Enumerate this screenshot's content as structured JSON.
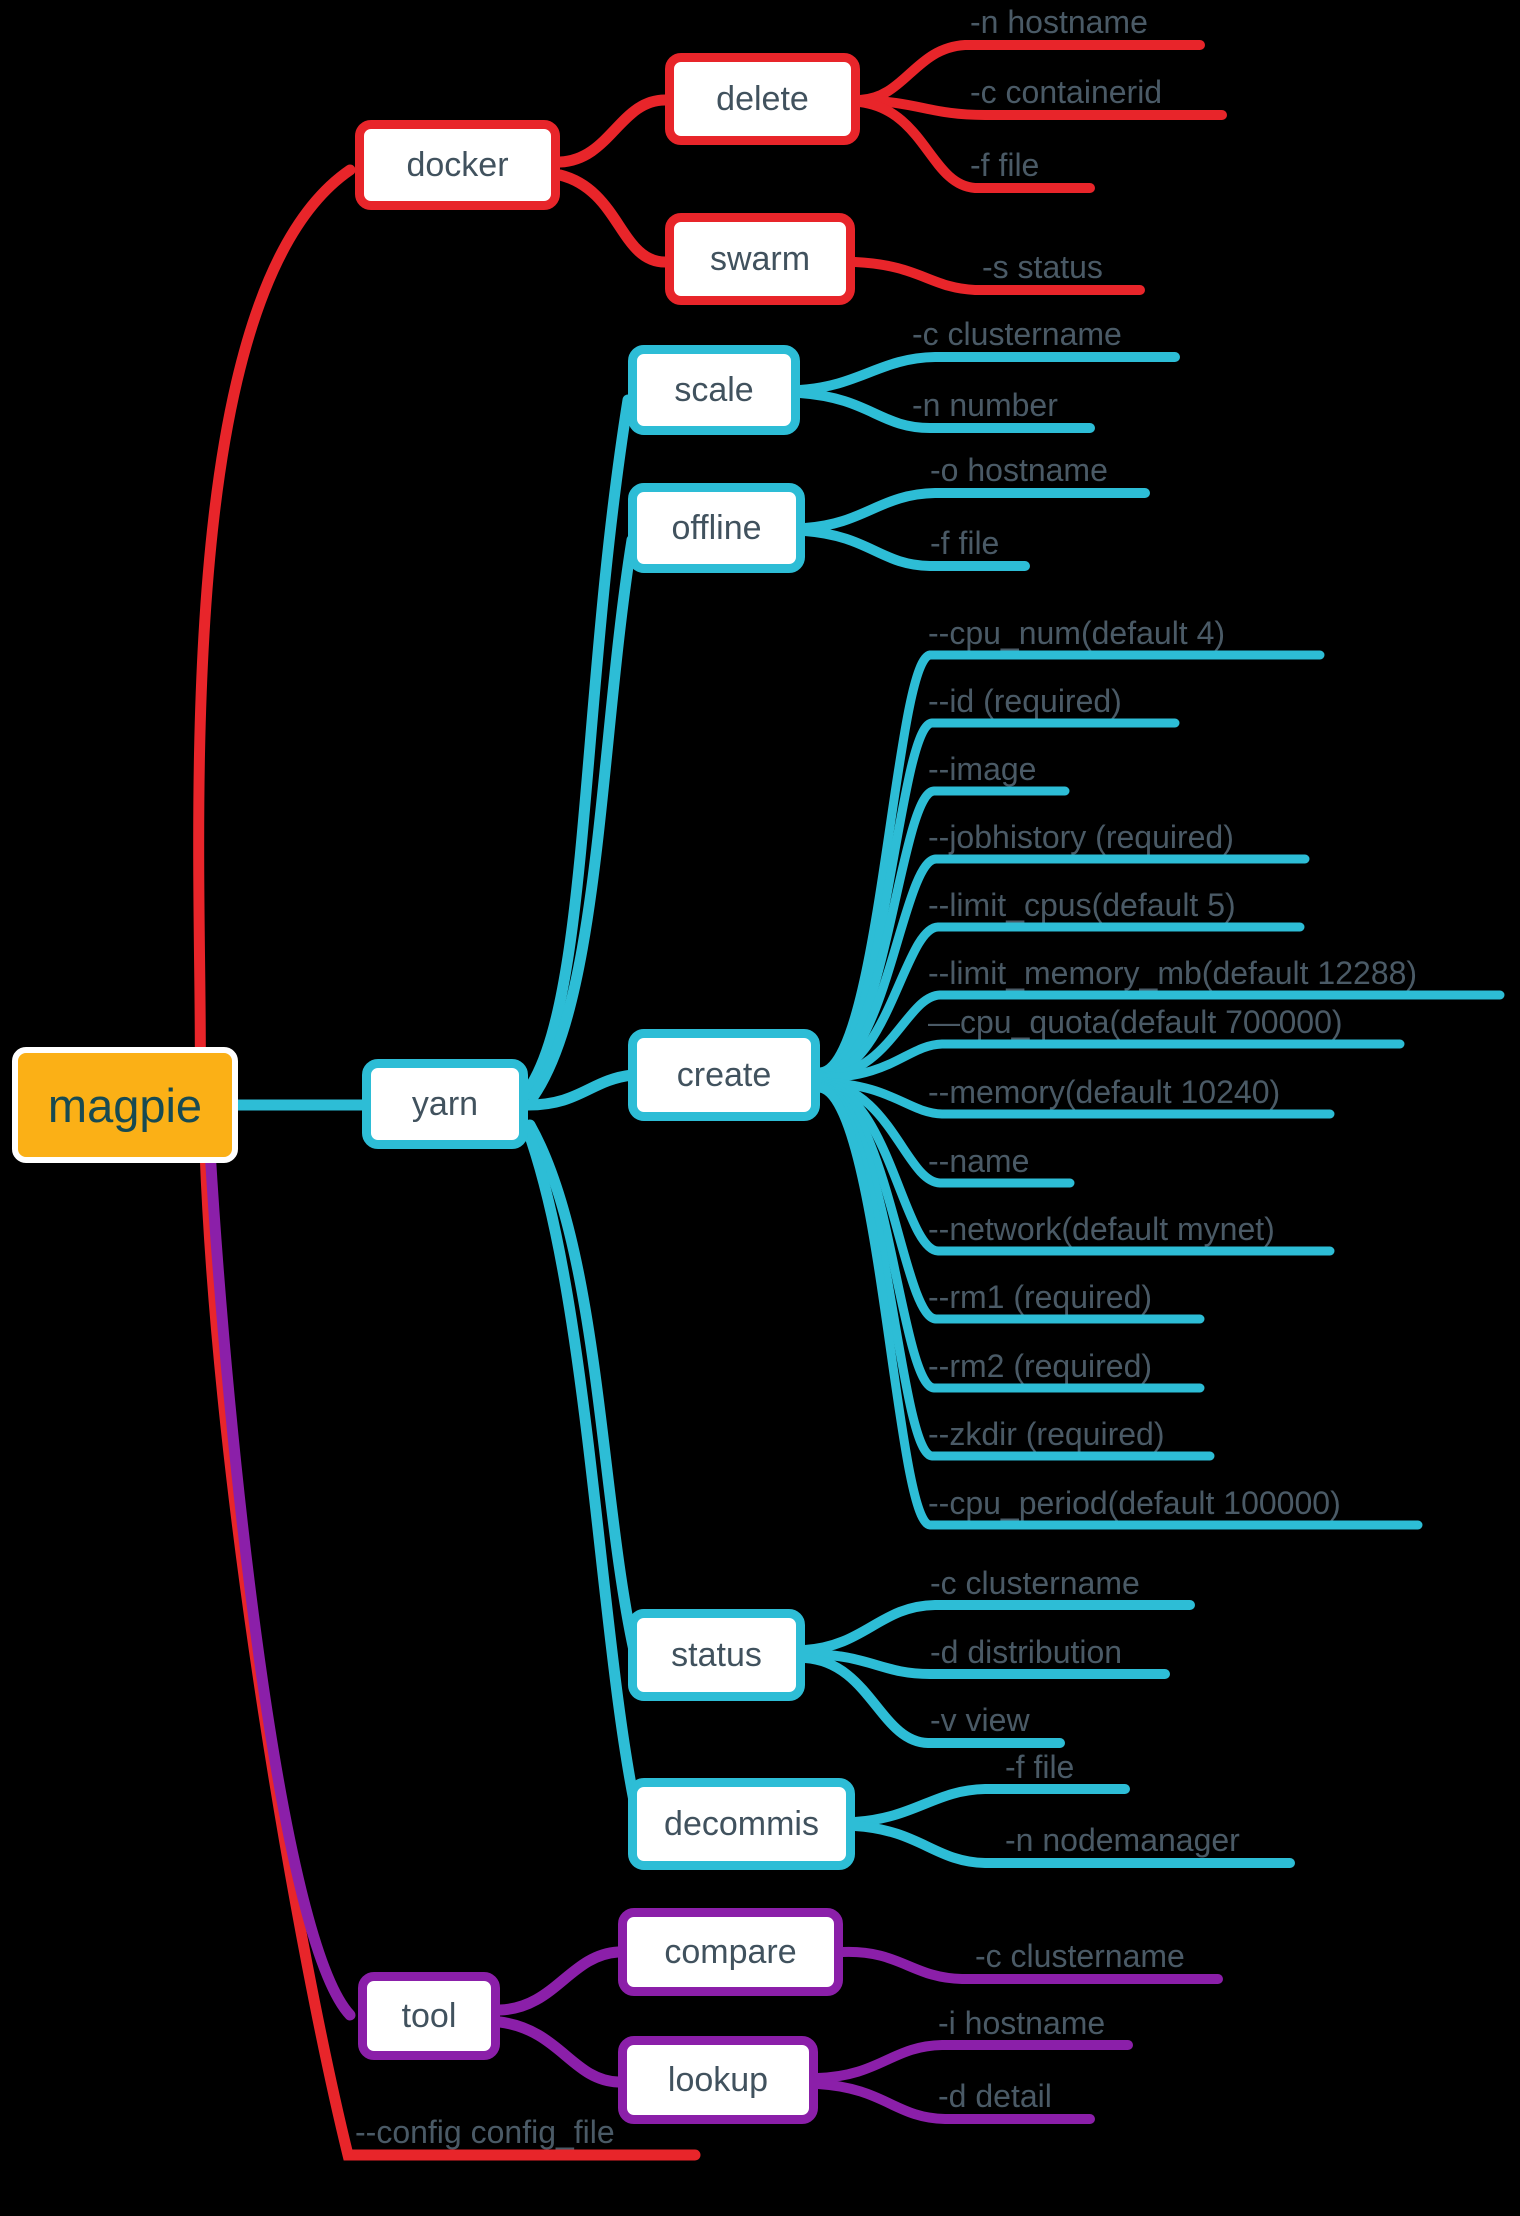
{
  "diagram": {
    "title": "magpie command mind map",
    "background": "#000000",
    "text_color": "#4A5A66",
    "root": {
      "label": "magpie",
      "fill": "#FBB016",
      "border": "#FFFFFF",
      "text": "#174A52"
    },
    "branch_colors": {
      "docker": "#E8252A",
      "yarn": "#2DBDD6",
      "tool": "#8B1FA9"
    },
    "branches": [
      {
        "id": "docker",
        "label": "docker",
        "color": "#E8252A",
        "children": [
          {
            "id": "delete",
            "label": "delete",
            "options": [
              "-n hostname",
              "-c containerid",
              "-f file"
            ]
          },
          {
            "id": "swarm",
            "label": "swarm",
            "options": [
              "-s status"
            ]
          }
        ]
      },
      {
        "id": "yarn",
        "label": "yarn",
        "color": "#2DBDD6",
        "children": [
          {
            "id": "scale",
            "label": "scale",
            "options": [
              "-c clustername",
              "-n number"
            ]
          },
          {
            "id": "offline",
            "label": "offline",
            "options": [
              "-o hostname",
              "-f file"
            ]
          },
          {
            "id": "create",
            "label": "create",
            "options": [
              "--cpu_num(default 4)",
              "--id (required)",
              "--image",
              "--jobhistory (required)",
              "--limit_cpus(default 5)",
              "--limit_memory_mb(default  12288)",
              "—cpu_quota(default 700000)",
              "--memory(default 10240)",
              "--name",
              "--network(default mynet)",
              "--rm1 (required)",
              "--rm2 (required)",
              "--zkdir (required)",
              "--cpu_period(default 100000)"
            ]
          },
          {
            "id": "status",
            "label": "status",
            "options": [
              "-c clustername",
              "-d distribution",
              "-v view"
            ]
          },
          {
            "id": "decommis",
            "label": "decommis",
            "options": [
              "-f file",
              "-n nodemanager"
            ]
          }
        ]
      },
      {
        "id": "tool",
        "label": "tool",
        "color": "#8B1FA9",
        "children": [
          {
            "id": "compare",
            "label": "compare",
            "options": [
              "-c clustername"
            ]
          },
          {
            "id": "lookup",
            "label": "lookup",
            "options": [
              "-i hostname",
              "-d detail"
            ]
          }
        ]
      }
    ],
    "root_options": [
      "--config config_file"
    ]
  }
}
